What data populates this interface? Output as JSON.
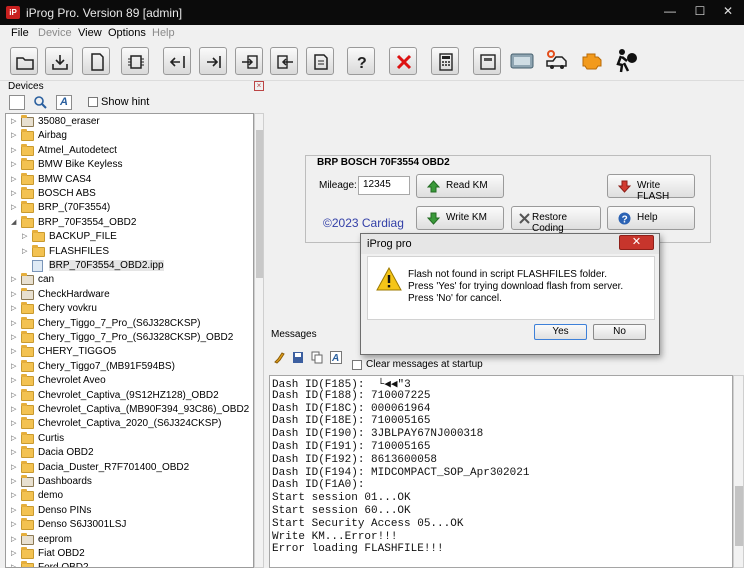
{
  "window": {
    "title": "iProg Pro. Version 89 [admin]",
    "app_icon_text": "iP",
    "min": "—",
    "max": "☐",
    "close": "✕"
  },
  "menu": {
    "file": "File",
    "device": "Device",
    "view": "View",
    "options": "Options",
    "help": "Help"
  },
  "devices_panel": {
    "title": "Devices",
    "show_hint": "Show hint",
    "items": [
      {
        "label": "35080_eraser",
        "type": "tool",
        "indent": 0
      },
      {
        "label": "Airbag",
        "type": "folder",
        "indent": 0
      },
      {
        "label": "Atmel_Autodetect",
        "type": "folder",
        "indent": 0
      },
      {
        "label": "BMW Bike Keyless",
        "type": "folder",
        "indent": 0
      },
      {
        "label": "BMW CAS4",
        "type": "folder",
        "indent": 0
      },
      {
        "label": "BOSCH ABS",
        "type": "folder",
        "indent": 0
      },
      {
        "label": "BRP_(70F3554)",
        "type": "folder",
        "indent": 0
      },
      {
        "label": "BRP_70F3554_OBD2",
        "type": "folder",
        "indent": 0,
        "expanded": true
      },
      {
        "label": "BACKUP_FILE",
        "type": "folder",
        "indent": 1
      },
      {
        "label": "FLASHFILES",
        "type": "folder",
        "indent": 1
      },
      {
        "label": "BRP_70F3554_OBD2.ipp",
        "type": "file",
        "indent": 1,
        "selected": true
      },
      {
        "label": "can",
        "type": "tool",
        "indent": 0
      },
      {
        "label": "CheckHardware",
        "type": "tool",
        "indent": 0
      },
      {
        "label": "Chery vovkru",
        "type": "folder",
        "indent": 0
      },
      {
        "label": "Chery_Tiggo_7_Pro_(S6J328CKSP)",
        "type": "folder",
        "indent": 0
      },
      {
        "label": "Chery_Tiggo_7_Pro_(S6J328CKSP)_OBD2",
        "type": "folder",
        "indent": 0
      },
      {
        "label": "CHERY_TIGGO5",
        "type": "folder",
        "indent": 0
      },
      {
        "label": "Chery_Tiggo7_(MB91F594BS)",
        "type": "folder",
        "indent": 0
      },
      {
        "label": "Chevrolet Aveo",
        "type": "folder",
        "indent": 0
      },
      {
        "label": "Chevrolet_Captiva_(9S12HZ128)_OBD2",
        "type": "folder",
        "indent": 0
      },
      {
        "label": "Chevrolet_Captiva_(MB90F394_93C86)_OBD2",
        "type": "folder",
        "indent": 0
      },
      {
        "label": "Chevrolet_Captiva_2020_(S6J324CKSP)",
        "type": "folder",
        "indent": 0
      },
      {
        "label": "Curtis",
        "type": "folder",
        "indent": 0
      },
      {
        "label": "Dacia OBD2",
        "type": "folder",
        "indent": 0
      },
      {
        "label": "Dacia_Duster_R7F701400_OBD2",
        "type": "folder",
        "indent": 0
      },
      {
        "label": "Dashboards",
        "type": "tool",
        "indent": 0
      },
      {
        "label": "demo",
        "type": "folder",
        "indent": 0
      },
      {
        "label": "Denso PINs",
        "type": "folder",
        "indent": 0
      },
      {
        "label": "Denso S6J3001LSJ",
        "type": "folder",
        "indent": 0
      },
      {
        "label": "eeprom",
        "type": "tool",
        "indent": 0
      },
      {
        "label": "Fiat OBD2",
        "type": "folder",
        "indent": 0
      },
      {
        "label": "Ford OBD2",
        "type": "folder",
        "indent": 0
      }
    ]
  },
  "device_panel": {
    "title": "BRP BOSCH 70F3554 OBD2",
    "mileage_label": "Mileage:",
    "mileage_value": "12345",
    "copyright": "©2023 Cardiag",
    "read_km": "Read KM",
    "write_km": "Write KM",
    "restore_coding": "Restore Coding",
    "write_flash": "Write FLASH",
    "help": "Help"
  },
  "messages": {
    "title": "Messages",
    "clear_at_startup": "Clear messages at startup",
    "lines": [
      "Dash ID(F185):  └◀◀\"3",
      "Dash ID(F188): 710007225",
      "Dash ID(F18C): 000061964",
      "Dash ID(F18E): 710005165",
      "Dash ID(F190): 3JBLPAY67NJ000318",
      "Dash ID(F191): 710005165",
      "Dash ID(F192): 8613600058",
      "Dash ID(F194): MIDCOMPACT_SOP_Apr302021",
      "Dash ID(F1A0):",
      "Start session 01...OK",
      "Start session 60...OK",
      "Start Security Access 05...OK",
      "Write KM...Error!!!",
      "Error loading FLASHFILE!!!"
    ]
  },
  "dialog": {
    "title": "iProg pro",
    "close": "✕",
    "message_lines": [
      "Flash not found in script FLASHFILES folder.",
      "Press 'Yes' for trying download flash from server.",
      "Press 'No' for cancel."
    ],
    "yes": "Yes",
    "no": "No"
  }
}
